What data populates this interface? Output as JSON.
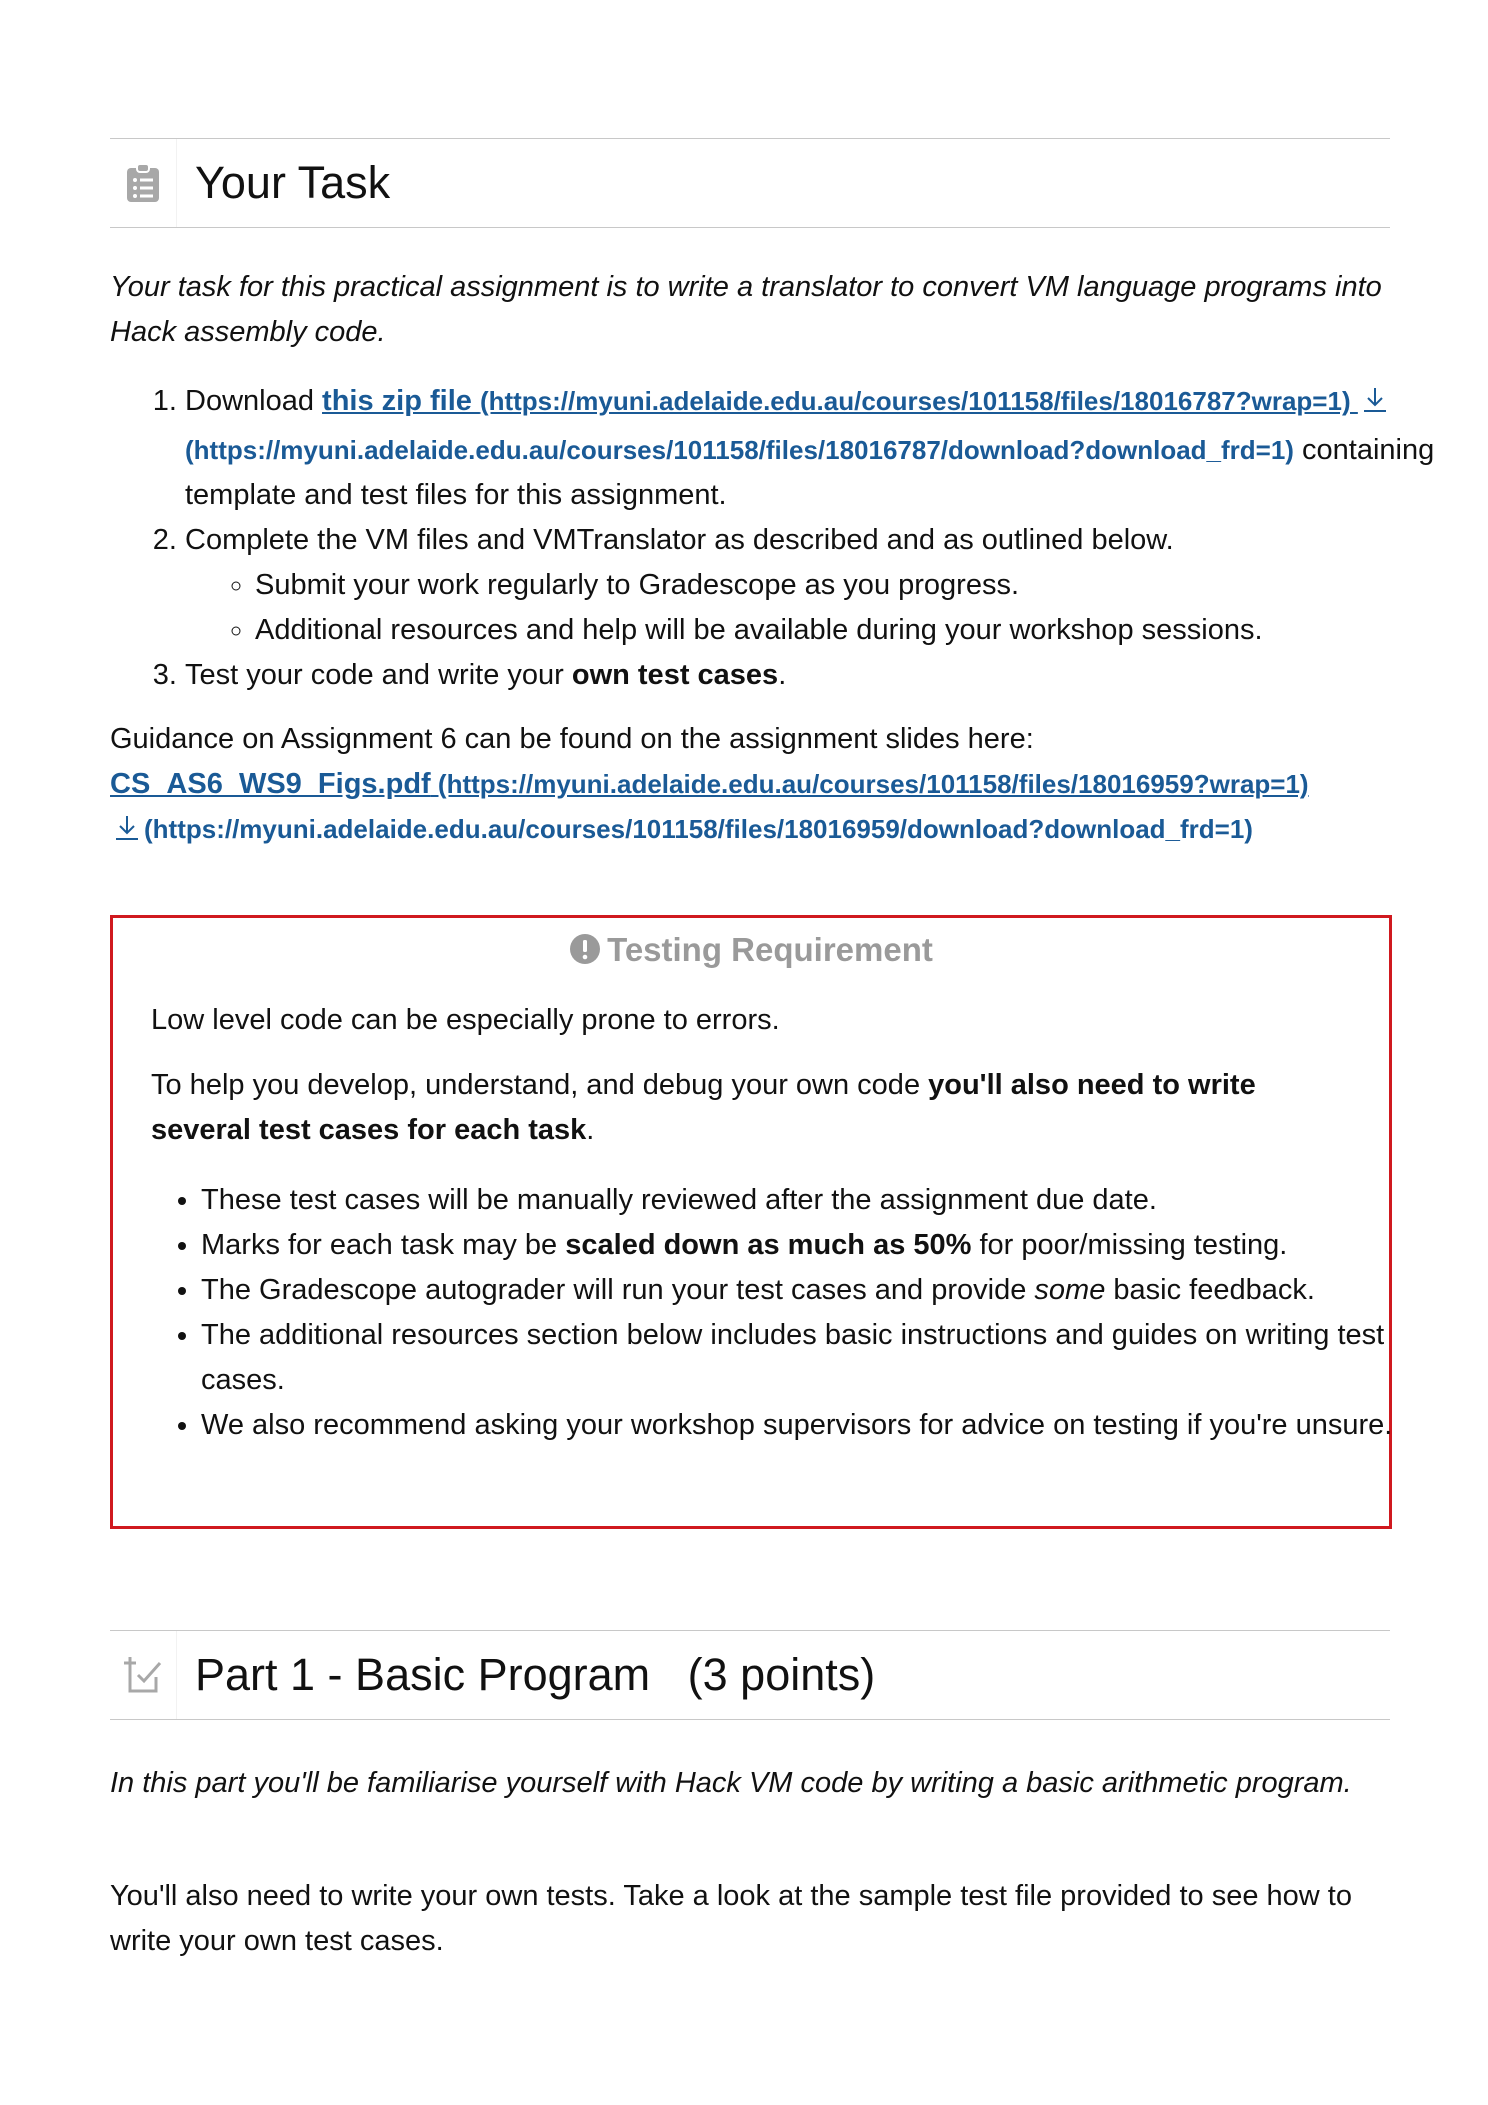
{
  "section1": {
    "title": "Your Task",
    "intro": "Your task for this practical assignment is to write a translator to convert VM language programs into Hack assembly code.",
    "step1": {
      "prefix": "Download ",
      "link_text": "this zip file ",
      "link_url1": "(https://myuni.adelaide.edu.au/courses/101158/files/18016787?wrap=1) ",
      "link_url2": "(https://myuni.adelaide.edu.au/courses/101158/files/18016787/download?download_frd=1)",
      "suffix": " containing template and test files for this assignment."
    },
    "step2": {
      "text": "Complete the VM files and VMTranslator as described and as outlined below.",
      "sub1": "Submit your work regularly to Gradescope as you progress.",
      "sub2": "Additional resources and help will be available during your workshop sessions."
    },
    "step3": {
      "prefix": "Test your code and write your ",
      "bold": "own test cases",
      "suffix": "."
    },
    "guidance": {
      "text": "Guidance on Assignment 6 can be found on the assignment slides here:",
      "link_text": "CS_AS6_WS9_Figs.pdf",
      "link_url1": " (https://myuni.adelaide.edu.au/courses/101158/files/18016959?wrap=1)",
      "link_url2": "(https://myuni.adelaide.edu.au/courses/101158/files/18016959/download?download_frd=1)"
    }
  },
  "callout": {
    "title": "Testing Requirement",
    "p1": "Low level code can be especially prone to errors.",
    "p2_prefix": "To help you develop, understand, and debug your own code ",
    "p2_bold": "you'll also need to write several test cases for each task",
    "p2_suffix": ".",
    "bullets": {
      "b1": "These test cases will be manually reviewed after the assignment due date.",
      "b2_prefix": "Marks for each task may be ",
      "b2_bold": "scaled down as much as 50%",
      "b2_suffix": " for poor/missing testing.",
      "b3_prefix": "The Gradescope autograder will run your test cases and provide ",
      "b3_italic": "some",
      "b3_suffix": " basic feedback.",
      "b4": "The additional resources section below includes basic instructions and guides on writing test cases.",
      "b5": "We also recommend asking your workshop supervisors for advice on testing if you're unsure."
    },
    "border_color": "#d0191f"
  },
  "section2": {
    "title": "Part 1 - Basic Program   (3 points)",
    "intro": "In this part you'll be familiarise yourself with Hack VM code by writing a basic arithmetic program.",
    "p2": "You'll also need to write your own tests. Take a look at the sample test file provided to see how to write your own test cases."
  },
  "colors": {
    "link": "#1a5a96",
    "icon": "#a8a8a8"
  },
  "icons": [
    "clipboard-list-icon",
    "download-icon",
    "alert-circle-icon",
    "add-task-checkbox-icon"
  ]
}
